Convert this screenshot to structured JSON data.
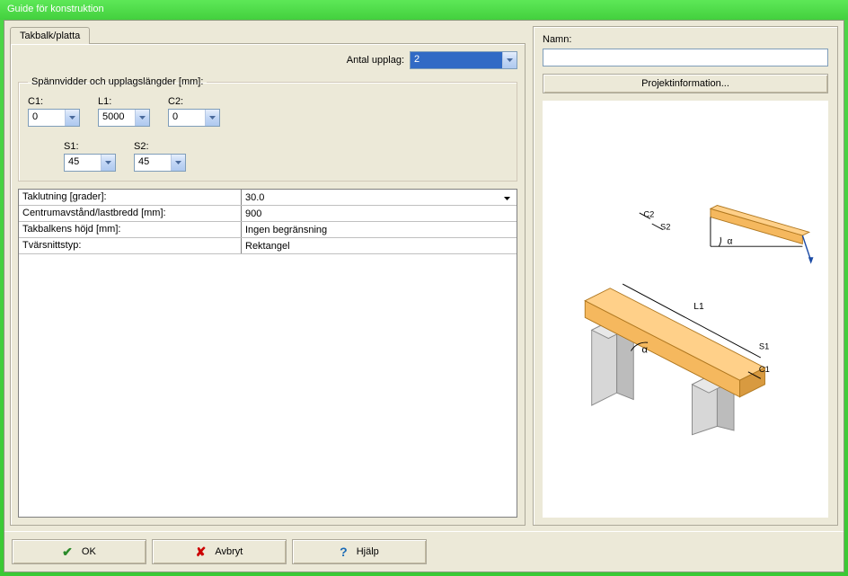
{
  "window": {
    "title": "Guide för konstruktion"
  },
  "tabs": {
    "main": "Takbalk/platta"
  },
  "upplag": {
    "label": "Antal upplag:",
    "value": "2"
  },
  "group": {
    "title": "Spännvidder och upplagslängder [mm]:"
  },
  "spans": {
    "c1": {
      "label": "C1:",
      "value": "0"
    },
    "l1": {
      "label": "L1:",
      "value": "5000"
    },
    "c2": {
      "label": "C2:",
      "value": "0"
    },
    "s1": {
      "label": "S1:",
      "value": "45"
    },
    "s2": {
      "label": "S2:",
      "value": "45"
    }
  },
  "props": {
    "taklutning": {
      "label": "Taklutning [grader]:",
      "value": "30.0"
    },
    "centrum": {
      "label": "Centrumavstånd/lastbredd [mm]:",
      "value": "900"
    },
    "hojd": {
      "label": "Takbalkens höjd [mm]:",
      "value": "Ingen begränsning"
    },
    "tvarsnitt": {
      "label": "Tvärsnittstyp:",
      "value": "Rektangel"
    }
  },
  "right": {
    "namn_label": "Namn:",
    "namn_value": "",
    "projinfo": "Projektinformation..."
  },
  "buttons": {
    "ok": "OK",
    "cancel": "Avbryt",
    "help": "Hjälp"
  },
  "diagram": {
    "l1": "L1",
    "c1": "C1",
    "c2": "C2",
    "s1": "S1",
    "s2": "S2",
    "alpha": "α"
  }
}
